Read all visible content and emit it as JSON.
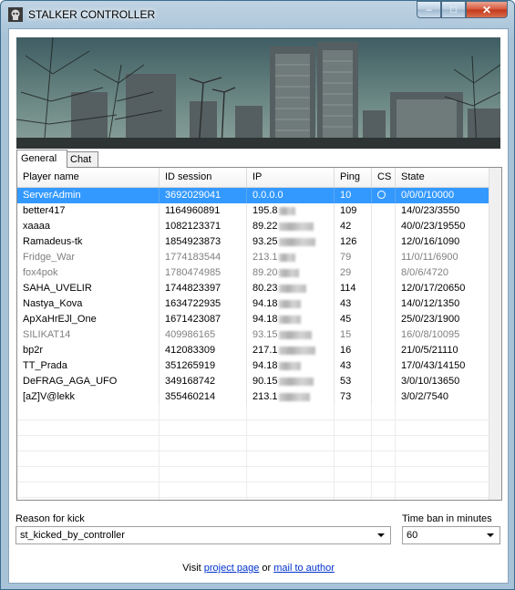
{
  "window": {
    "title": "STALKER CONTROLLER",
    "minimize_label": "–",
    "maximize_label": "□",
    "close_label": "✕"
  },
  "tabs": [
    {
      "label": "General"
    },
    {
      "label": "Chat"
    }
  ],
  "table": {
    "columns": [
      "Player name",
      "ID session",
      "IP",
      "Ping",
      "CS",
      "State"
    ],
    "rows": [
      {
        "name": "ServerAdmin",
        "id": "3692029041",
        "ip": "0.0.0.0",
        "ping": "10",
        "state": "0/0/0/10000",
        "selected": true,
        "dim": false,
        "cs": true
      },
      {
        "name": "better417",
        "id": "1164960891",
        "ip": "195.8",
        "ping": "109",
        "state": "14/0/23/3550",
        "selected": false,
        "dim": false,
        "cs": false
      },
      {
        "name": "xaaaa",
        "id": "1082123371",
        "ip": "89.22",
        "ping": "42",
        "state": "40/0/23/19550",
        "selected": false,
        "dim": false,
        "cs": false
      },
      {
        "name": "Ramadeus-tk",
        "id": "1854923873",
        "ip": "93.25",
        "ping": "126",
        "state": "12/0/16/1090",
        "selected": false,
        "dim": false,
        "cs": false
      },
      {
        "name": "Fridge_War",
        "id": "1774183544",
        "ip": "213.1",
        "ping": "79",
        "state": "11/0/11/6900",
        "selected": false,
        "dim": true,
        "cs": false
      },
      {
        "name": "fox4pok",
        "id": "1780474985",
        "ip": "89.20",
        "ping": "29",
        "state": "8/0/6/4720",
        "selected": false,
        "dim": true,
        "cs": false
      },
      {
        "name": "SAHA_UVELIR",
        "id": "1744823397",
        "ip": "80.23",
        "ping": "114",
        "state": "12/0/17/20650",
        "selected": false,
        "dim": false,
        "cs": false
      },
      {
        "name": "Nastya_Kova",
        "id": "1634722935",
        "ip": "94.18",
        "ping": "43",
        "state": "14/0/12/1350",
        "selected": false,
        "dim": false,
        "cs": false
      },
      {
        "name": "ApXaHrEJl_One",
        "id": "1671423087",
        "ip": "94.18",
        "ping": "45",
        "state": "25/0/23/1900",
        "selected": false,
        "dim": false,
        "cs": false
      },
      {
        "name": "SILIKAT14",
        "id": "409986165",
        "ip": "93.15",
        "ping": "15",
        "state": "16/0/8/10095",
        "selected": false,
        "dim": true,
        "cs": false
      },
      {
        "name": "bp2r",
        "id": "412083309",
        "ip": "217.1",
        "ping": "16",
        "state": "21/0/5/21110",
        "selected": false,
        "dim": false,
        "cs": false
      },
      {
        "name": "TT_Prada",
        "id": "351265919",
        "ip": "94.18",
        "ping": "43",
        "state": "17/0/43/14150",
        "selected": false,
        "dim": false,
        "cs": false
      },
      {
        "name": "DeFRAG_AGA_UFO",
        "id": "349168742",
        "ip": "90.15",
        "ping": "53",
        "state": "3/0/10/13650",
        "selected": false,
        "dim": false,
        "cs": false
      },
      {
        "name": "[aZ]V@lekk",
        "id": "355460214",
        "ip": "213.1",
        "ping": "73",
        "state": "3/0/2/7540",
        "selected": false,
        "dim": false,
        "cs": false
      }
    ]
  },
  "kick": {
    "label": "Reason for kick",
    "value": "st_kicked_by_controller"
  },
  "ban": {
    "label": "Time ban in minutes",
    "value": "60"
  },
  "footer": {
    "visit": "Visit",
    "project_link": "project page",
    "or": "or",
    "mail_link": "mail to author"
  },
  "colors": {
    "selection": "#3399ff",
    "link": "#0033cc",
    "title_bar": "#a8c3d8"
  }
}
